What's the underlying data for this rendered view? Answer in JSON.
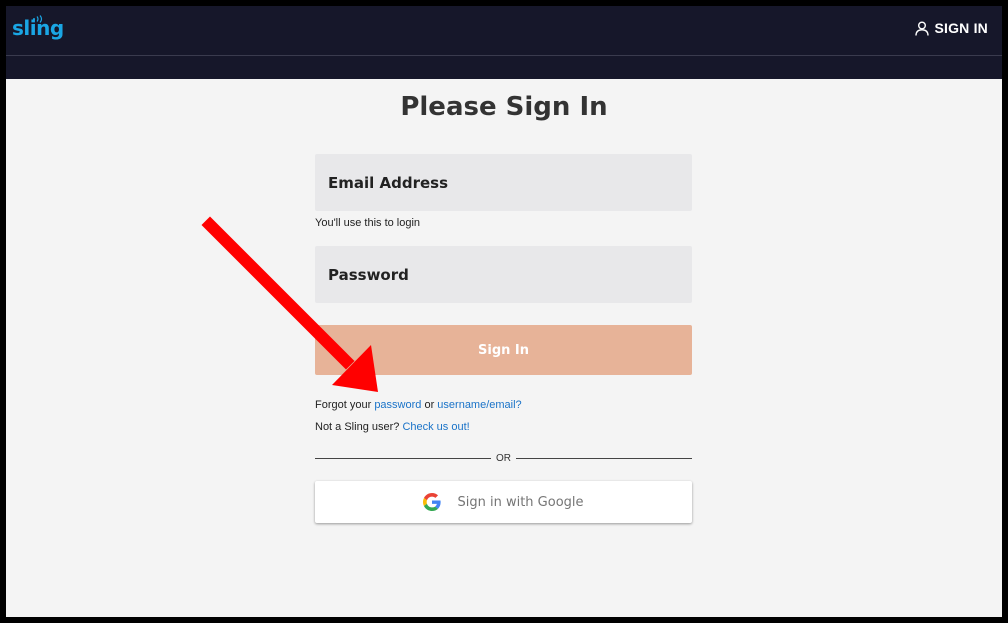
{
  "header": {
    "logo_text": "sling",
    "signin_label": "SIGN IN"
  },
  "page": {
    "title": "Please Sign In"
  },
  "form": {
    "email_placeholder": "Email Address",
    "email_hint": "You'll use this to login",
    "password_placeholder": "Password",
    "submit_label": "Sign In",
    "forgot_prefix": "Forgot your ",
    "forgot_password_link": "password",
    "forgot_or": " or ",
    "forgot_username_link": "username/email?",
    "notuser_prefix": "Not a Sling user? ",
    "notuser_link": "Check us out!",
    "divider_label": "OR",
    "google_label": "Sign in with Google"
  },
  "icons": {
    "user": "user-icon",
    "google": "google-icon",
    "arrow": "red-arrow-annotation"
  },
  "colors": {
    "topbar": "#16172a",
    "brand": "#1aa6e4",
    "button": "#e7b398",
    "link": "#1a73c8",
    "arrow": "#ff0000"
  }
}
